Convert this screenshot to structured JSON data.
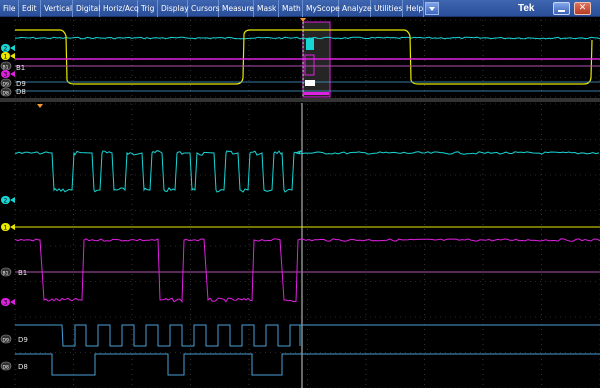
{
  "menu": {
    "items": [
      "File",
      "Edit",
      "Vertical",
      "Digital",
      "Horiz/Acq",
      "Trig",
      "Display",
      "Cursors",
      "Measure",
      "Mask",
      "Math",
      "MyScope",
      "Analyze",
      "Utilities",
      "Help"
    ]
  },
  "brand": "Tek",
  "window_controls": {
    "close_glyph": "✕"
  },
  "colors": {
    "ch1": "#e8e800",
    "ch2": "#19d6d6",
    "ch3": "#e020e0",
    "bus": "#b050b0",
    "digital": "#4a9fd8",
    "grid": "#555555",
    "background": "#000000"
  },
  "overview": {
    "labels": {
      "bus": "B1",
      "d9": "D9",
      "d8": "D8"
    },
    "markers": {
      "ch1": "1",
      "ch2": "2",
      "ch3": "3",
      "bus": "B1",
      "d9": "D9",
      "d8": "D8"
    }
  },
  "zoom": {
    "labels": {
      "bus": "B1",
      "d9": "D9",
      "d8": "D8"
    },
    "markers": {
      "ch1": "1",
      "ch2": "2",
      "ch3": "3",
      "bus": "B1",
      "d9": "D9",
      "d8": "D8"
    }
  }
}
